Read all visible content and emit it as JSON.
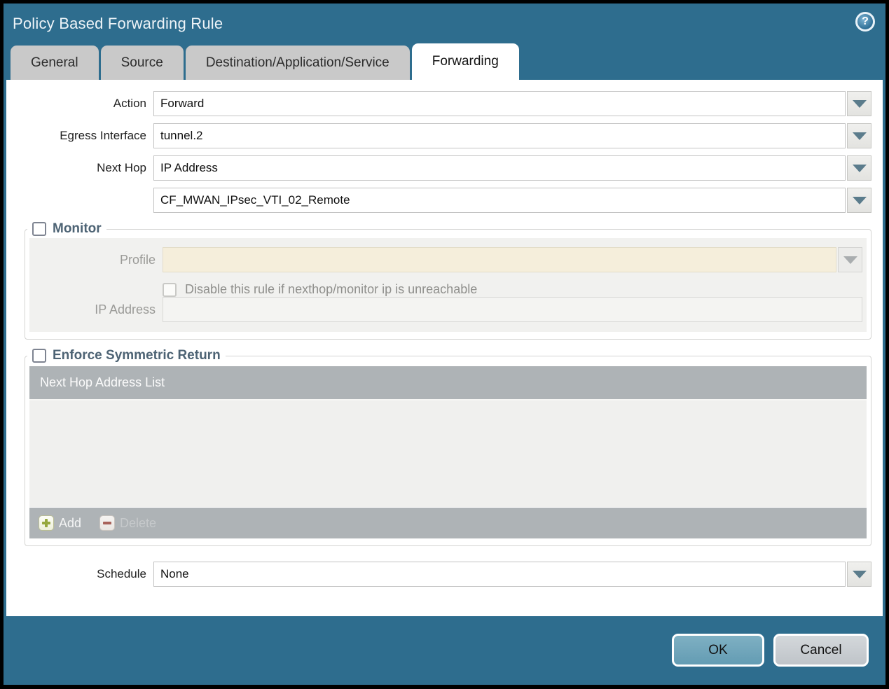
{
  "window": {
    "title": "Policy Based Forwarding Rule"
  },
  "tabs": [
    {
      "label": "General",
      "active": false
    },
    {
      "label": "Source",
      "active": false
    },
    {
      "label": "Destination/Application/Service",
      "active": false
    },
    {
      "label": "Forwarding",
      "active": true
    }
  ],
  "form": {
    "action": {
      "label": "Action",
      "value": "Forward"
    },
    "egress_interface": {
      "label": "Egress Interface",
      "value": "tunnel.2"
    },
    "next_hop": {
      "label": "Next Hop",
      "value": "IP Address"
    },
    "next_hop_address": {
      "value": "CF_MWAN_IPsec_VTI_02_Remote"
    },
    "schedule": {
      "label": "Schedule",
      "value": "None"
    }
  },
  "monitor": {
    "legend": "Monitor",
    "checked": false,
    "profile": {
      "label": "Profile",
      "value": ""
    },
    "disable_rule": {
      "label": "Disable this rule if nexthop/monitor ip is unreachable",
      "checked": false
    },
    "ip_address": {
      "label": "IP Address",
      "value": ""
    }
  },
  "symmetric_return": {
    "legend": "Enforce Symmetric Return",
    "checked": false,
    "table": {
      "header": "Next Hop Address List",
      "rows": []
    },
    "add_label": "Add",
    "delete_label": "Delete",
    "delete_disabled": true
  },
  "footer": {
    "ok_label": "OK",
    "cancel_label": "Cancel"
  },
  "icons": {
    "help": "help-icon",
    "dropdown": "chevron-down-icon",
    "add": "plus-icon",
    "delete": "minus-icon"
  },
  "colors": {
    "titlebar_teal": "#2e6d8e",
    "active_tab_bg": "#ffffff",
    "inactive_tab_bg": "#c9c9c9",
    "legend_text": "#4d6374",
    "disabled_field_beige": "#f5eedb",
    "panel_gray": "#f1f1ef",
    "table_bar_gray": "#aeb3b6",
    "dropdown_arrow": "#5b7c8c",
    "add_icon_green": "#96a83e",
    "delete_icon_red": "#a8625a",
    "ok_button_bg": "#6fa5bb",
    "cancel_button_bg": "#c9cdd1"
  }
}
